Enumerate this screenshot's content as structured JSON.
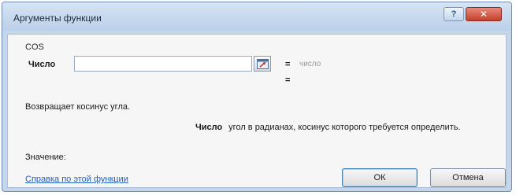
{
  "dialog": {
    "title": "Аргументы функции",
    "help_button": "?",
    "close_button": "✕"
  },
  "function": {
    "name": "COS",
    "argument_label": "Число",
    "argument_value": "",
    "argument_hint": "число",
    "equals_1": "=",
    "equals_2": "=",
    "description": "Возвращает косинус угла.",
    "argument_description_name": "Число",
    "argument_description": "угол в радианах, косинус которого требуется определить."
  },
  "footer": {
    "value_label": "Значение:",
    "help_link": "Справка по этой функции",
    "ok_label": "ОК",
    "cancel_label": "Отмена"
  }
}
